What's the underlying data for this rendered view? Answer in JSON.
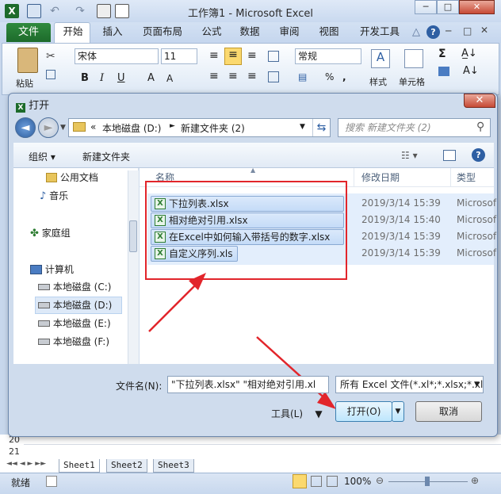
{
  "window": {
    "title": "工作簿1 - Microsoft Excel"
  },
  "ribbon_tabs": [
    "文件",
    "开始",
    "插入",
    "页面布局",
    "公式",
    "数据",
    "审阅",
    "视图",
    "开发工具"
  ],
  "ribbon": {
    "paste_label": "粘贴",
    "font_name": "宋体",
    "font_size": "11",
    "number_format": "常规",
    "style_label": "样式",
    "cell_label": "单元格"
  },
  "dialog": {
    "title": "打开",
    "breadcrumb": [
      "本地磁盘 (D:)",
      "新建文件夹 (2)"
    ],
    "search_placeholder": "搜索 新建文件夹 (2)",
    "organize_label": "组织",
    "new_folder_label": "新建文件夹",
    "nav_items": [
      {
        "label": "公用文档",
        "icon": "folder-icon"
      },
      {
        "label": "音乐",
        "icon": "music-icon"
      },
      {
        "label": "家庭组",
        "icon": "homegroup-icon"
      },
      {
        "label": "计算机",
        "icon": "computer-icon"
      },
      {
        "label": "本地磁盘 (C:)",
        "icon": "drive-icon"
      },
      {
        "label": "本地磁盘 (D:)",
        "icon": "drive-icon"
      },
      {
        "label": "本地磁盘 (E:)",
        "icon": "drive-icon"
      },
      {
        "label": "本地磁盘 (F:)",
        "icon": "drive-icon"
      }
    ],
    "columns": {
      "name": "名称",
      "modified": "修改日期",
      "type": "类型"
    },
    "files": [
      {
        "name": "下拉列表.xlsx",
        "date": "2019/3/14 15:39",
        "type": "Microsof"
      },
      {
        "name": "相对绝对引用.xlsx",
        "date": "2019/3/14 15:40",
        "type": "Microsof"
      },
      {
        "name": "在Excel中如何输入带括号的数字.xlsx",
        "date": "2019/3/14 15:39",
        "type": "Microsof"
      },
      {
        "name": "自定义序列.xls",
        "date": "2019/3/14 15:39",
        "type": "Microsof"
      }
    ],
    "filename_label": "文件名(N):",
    "filename_value": "\"下拉列表.xlsx\" \"相对绝对引用.xl",
    "filetype_value": "所有 Excel 文件(*.xl*;*.xlsx;*.xl",
    "tools_label": "工具(L)",
    "open_label": "打开(O)",
    "cancel_label": "取消"
  },
  "sheet": {
    "rows": [
      "20",
      "21"
    ],
    "tabs": [
      "Sheet1",
      "Sheet2",
      "Sheet3"
    ],
    "status": "就绪",
    "zoom": "100%"
  },
  "colors": {
    "accent_red": "#e2252b",
    "excel_green": "#1d6b2b",
    "selection": "#c4dbf7"
  }
}
